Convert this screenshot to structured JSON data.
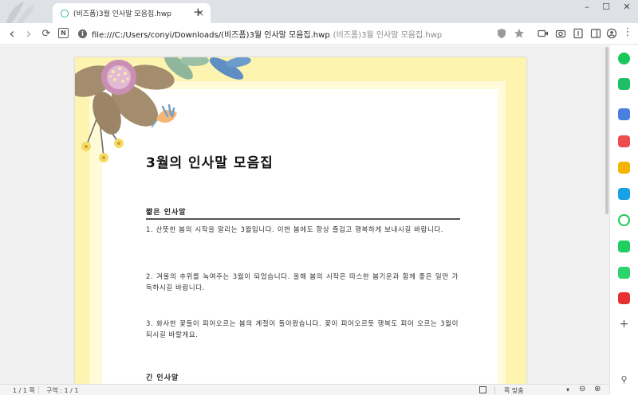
{
  "browser": {
    "tab_title": "(비즈폼)3월 인사말 모음집.hwp",
    "tab_close": "×",
    "new_tab": "+",
    "win_minimize": "–",
    "win_maximize": "☐",
    "win_close": "✕"
  },
  "toolbar": {
    "back": "‹",
    "forward": "›",
    "reload": "⟳",
    "ext_badge": "N",
    "url": "file:///C:/Users/conyi/Downloads/(비즈폼)3월 인사말 모음집.hwp",
    "url_ghost": "(비즈폼)3월 인사말 모음집.hwp"
  },
  "document": {
    "title": "3월의 인사말 모음집",
    "sections": [
      {
        "title": "짧은 인사말",
        "paragraphs": [
          "1. 산뜻한 봄의 시작을 알리는 3월입니다. 이번 봄에도 항상 즐겁고 행복하게 보내시길 바랍니다.",
          "2. 겨울의 추위를 녹여주는 3월이 되었습니다. 올해 봄의 시작은 따스한 봄기운과 함께 좋은 일만 가득하시길 바랍니다.",
          "3. 화사한 꽃들이 피어오르는 봄의 계절이 돌아왔습니다. 꽃이 피어오르듯 행복도 피어 오르는 3월이 되시길 바랄게요."
        ]
      },
      {
        "title": "긴 인사말",
        "paragraphs": []
      }
    ]
  },
  "statusbar": {
    "page": "1 / 1 쪽",
    "section": "구역 : 1 / 1",
    "zoom_mode": "쪽 맞춤",
    "zoom_dropdown": "▾",
    "zoom_out": "⊖",
    "zoom_in": "⊕"
  },
  "colors": {
    "page_frame": "#fdf4b0",
    "page_inner": "#fffbd8",
    "tab_strip": "#dee1e6"
  }
}
